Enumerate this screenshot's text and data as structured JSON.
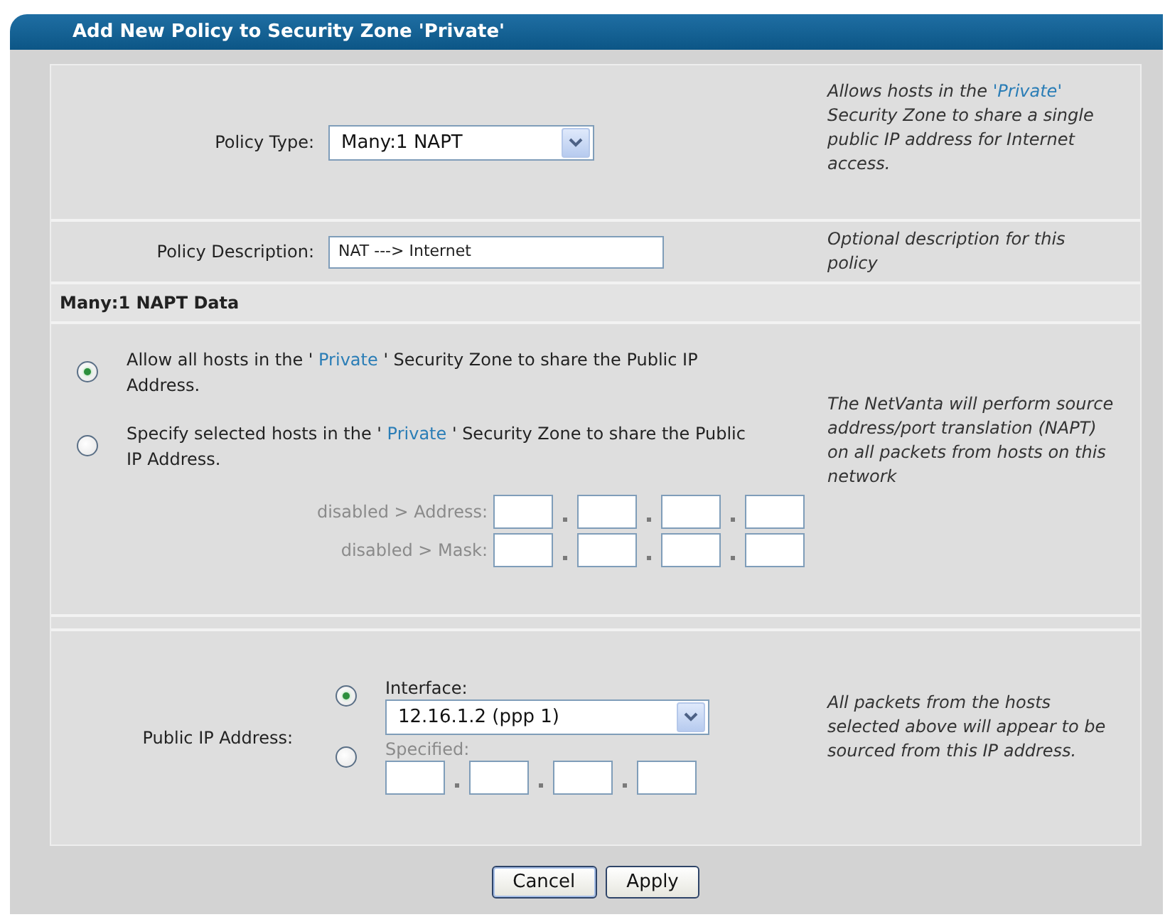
{
  "dialog": {
    "title": "Add New Policy to Security Zone 'Private'"
  },
  "policy_type": {
    "label": "Policy Type:",
    "value": "Many:1 NAPT",
    "help": {
      "before": "Allows hosts in the ",
      "zone": "'Private'",
      "after": " Security Zone to share a single public IP address for Internet access."
    }
  },
  "policy_description": {
    "label": "Policy Description:",
    "value": "NAT ---> Internet",
    "help": "Optional description for this policy"
  },
  "section": {
    "title": "Many:1 NAPT Data"
  },
  "hosts": {
    "options": [
      {
        "before": "Allow all hosts in the ' ",
        "zone": "Private",
        "after": " ' Security Zone to share the Public IP Address.",
        "selected": true
      },
      {
        "before": "Specify selected hosts in the ' ",
        "zone": "Private",
        "after": " ' Security Zone to share the Public IP Address.",
        "selected": false
      }
    ],
    "ip_rows": [
      {
        "label": "disabled > Address:",
        "disabled": true
      },
      {
        "label": "disabled > Mask:",
        "disabled": true
      }
    ],
    "help": "The NetVanta will perform source address/port translation (NAPT) on all packets from hosts on this network"
  },
  "public_ip": {
    "label": "Public IP Address:",
    "options": [
      {
        "kind": "select",
        "label": "Interface:",
        "value": "12.16.1.2 (ppp 1)",
        "selected": true,
        "disabled": false
      },
      {
        "kind": "ip",
        "label": "Specified:",
        "selected": false,
        "disabled": true
      }
    ],
    "help": "All packets from the hosts selected above will appear to be sourced from this IP address."
  },
  "buttons": [
    {
      "label": "Cancel",
      "default": true
    },
    {
      "label": "Apply",
      "default": false
    }
  ]
}
